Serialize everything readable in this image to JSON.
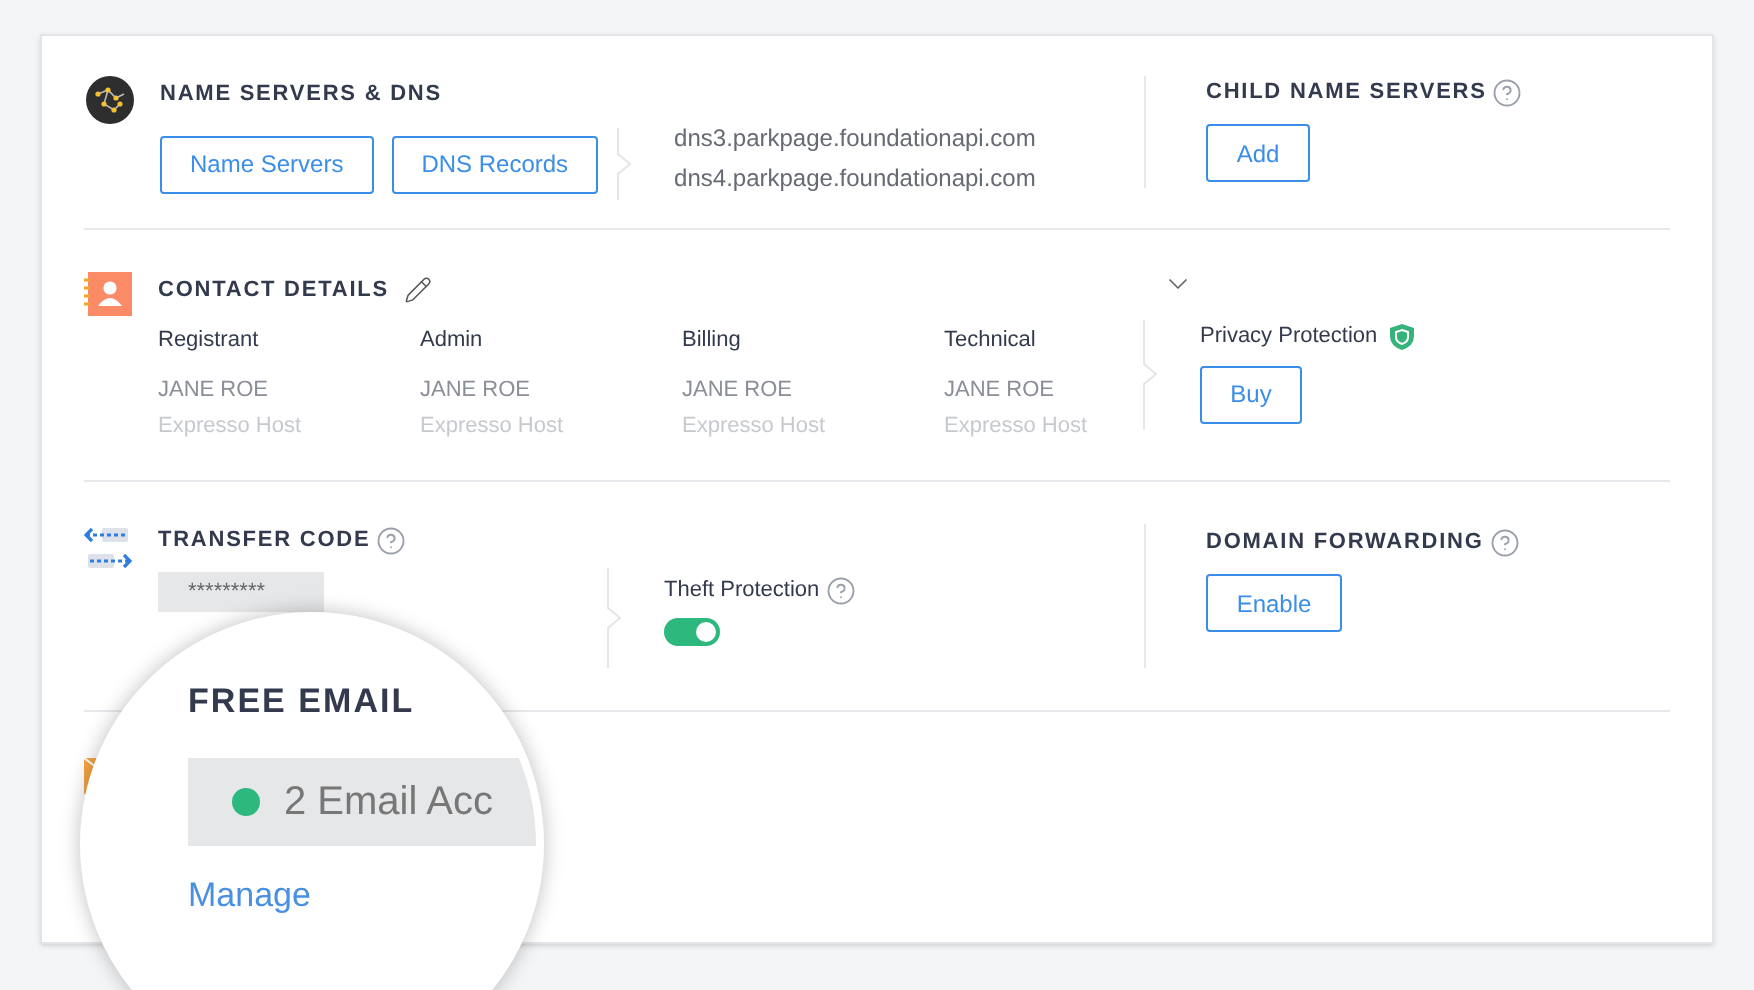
{
  "name_servers": {
    "title": "NAME SERVERS & DNS",
    "buttons": [
      "Name Servers",
      "DNS Records"
    ],
    "servers": [
      "dns3.parkpage.foundationapi.com",
      "dns4.parkpage.foundationapi.com"
    ]
  },
  "child_name_servers": {
    "title": "CHILD NAME SERVERS",
    "button": "Add"
  },
  "contact_details": {
    "title": "CONTACT DETAILS",
    "contacts": [
      {
        "role": "Registrant",
        "name": "JANE ROE",
        "organization": "Expresso Host"
      },
      {
        "role": "Admin",
        "name": "JANE ROE",
        "organization": "Expresso Host"
      },
      {
        "role": "Billing",
        "name": "JANE ROE",
        "organization": "Expresso Host"
      },
      {
        "role": "Technical",
        "name": "JANE ROE",
        "organization": "Expresso Host"
      }
    ]
  },
  "privacy_protection": {
    "label": "Privacy Protection",
    "button": "Buy"
  },
  "transfer_code": {
    "title": "TRANSFER CODE",
    "value": "*********"
  },
  "theft_protection": {
    "label": "Theft Protection",
    "on": true
  },
  "domain_forwarding": {
    "title": "DOMAIN FORWARDING",
    "button": "Enable"
  },
  "magnifier": {
    "title": "FREE EMAIL",
    "status": "2 Email Acc",
    "link": "Manage"
  }
}
